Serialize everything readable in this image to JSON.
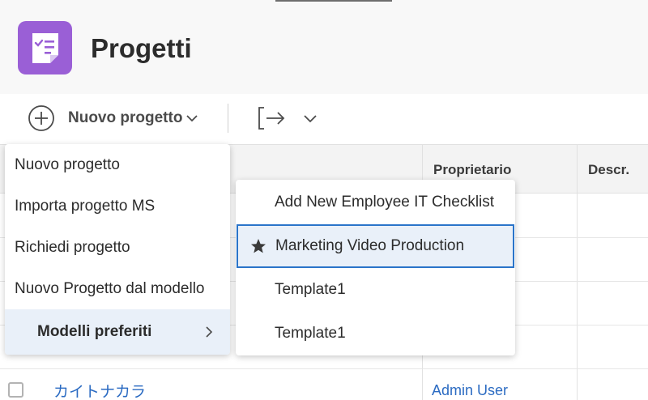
{
  "header": {
    "title": "Progetti",
    "app_icon": "project-checklist-icon",
    "app_color": "#9a5fd6"
  },
  "toolbar": {
    "new_project_label": "Nuovo progetto",
    "new_project_icon": "plus-circle-icon",
    "export_icon": "export-icon"
  },
  "table": {
    "columns": [
      "Proprietario",
      "Descr."
    ],
    "rows": [
      {
        "name": "カイトナカラ",
        "owner": "Admin User"
      }
    ]
  },
  "menu": {
    "items": [
      {
        "label": "Nuovo progetto"
      },
      {
        "label": "Importa progetto MS"
      },
      {
        "label": "Richiedi progetto"
      },
      {
        "label": "Nuovo Progetto dal modello"
      },
      {
        "label": "Modelli preferiti"
      }
    ]
  },
  "submenu": {
    "items": [
      {
        "label": "Add New Employee IT Checklist",
        "starred": false
      },
      {
        "label": "Marketing Video Production",
        "starred": true
      },
      {
        "label": "Template1",
        "starred": false
      },
      {
        "label": "Template1",
        "starred": false
      }
    ]
  },
  "colors": {
    "accent": "#2a74c9",
    "link": "#2b6bc2",
    "highlight": "#e9f0f9"
  }
}
